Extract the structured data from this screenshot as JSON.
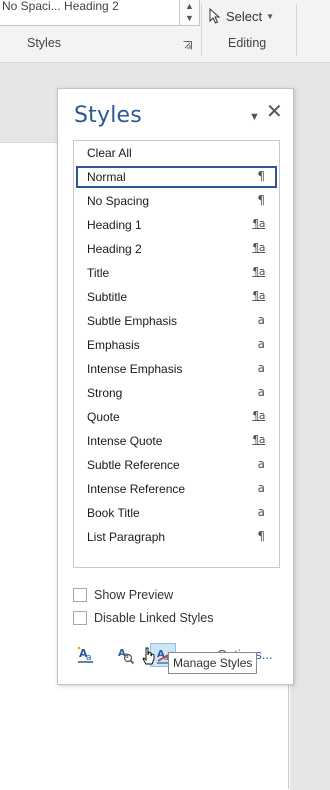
{
  "ribbon": {
    "gallery_text": "No Spaci...   Heading 2",
    "select_label": "Select",
    "styles_group_label": "Styles",
    "editing_group_label": "Editing"
  },
  "styles_pane": {
    "title": "Styles",
    "close_glyph": "✕",
    "menu_glyph": "▼",
    "styles": [
      {
        "name": "Clear All",
        "type": ""
      },
      {
        "name": "Normal",
        "type": "¶",
        "selected": true
      },
      {
        "name": "No Spacing",
        "type": "¶"
      },
      {
        "name": "Heading 1",
        "type": "¶a"
      },
      {
        "name": "Heading 2",
        "type": "¶a"
      },
      {
        "name": "Title",
        "type": "¶a"
      },
      {
        "name": "Subtitle",
        "type": "¶a"
      },
      {
        "name": "Subtle Emphasis",
        "type": "a"
      },
      {
        "name": "Emphasis",
        "type": "a"
      },
      {
        "name": "Intense Emphasis",
        "type": "a"
      },
      {
        "name": "Strong",
        "type": "a"
      },
      {
        "name": "Quote",
        "type": "¶a"
      },
      {
        "name": "Intense Quote",
        "type": "¶a"
      },
      {
        "name": "Subtle Reference",
        "type": "a"
      },
      {
        "name": "Intense Reference",
        "type": "a"
      },
      {
        "name": "Book Title",
        "type": "a"
      },
      {
        "name": "List Paragraph",
        "type": "¶"
      }
    ],
    "show_preview_label": "Show Preview",
    "disable_linked_label": "Disable Linked Styles",
    "options_label": "Options...",
    "tooltip": "Manage Styles"
  },
  "colors": {
    "accent": "#2b579a",
    "active_button_bg": "#cde6f7"
  }
}
